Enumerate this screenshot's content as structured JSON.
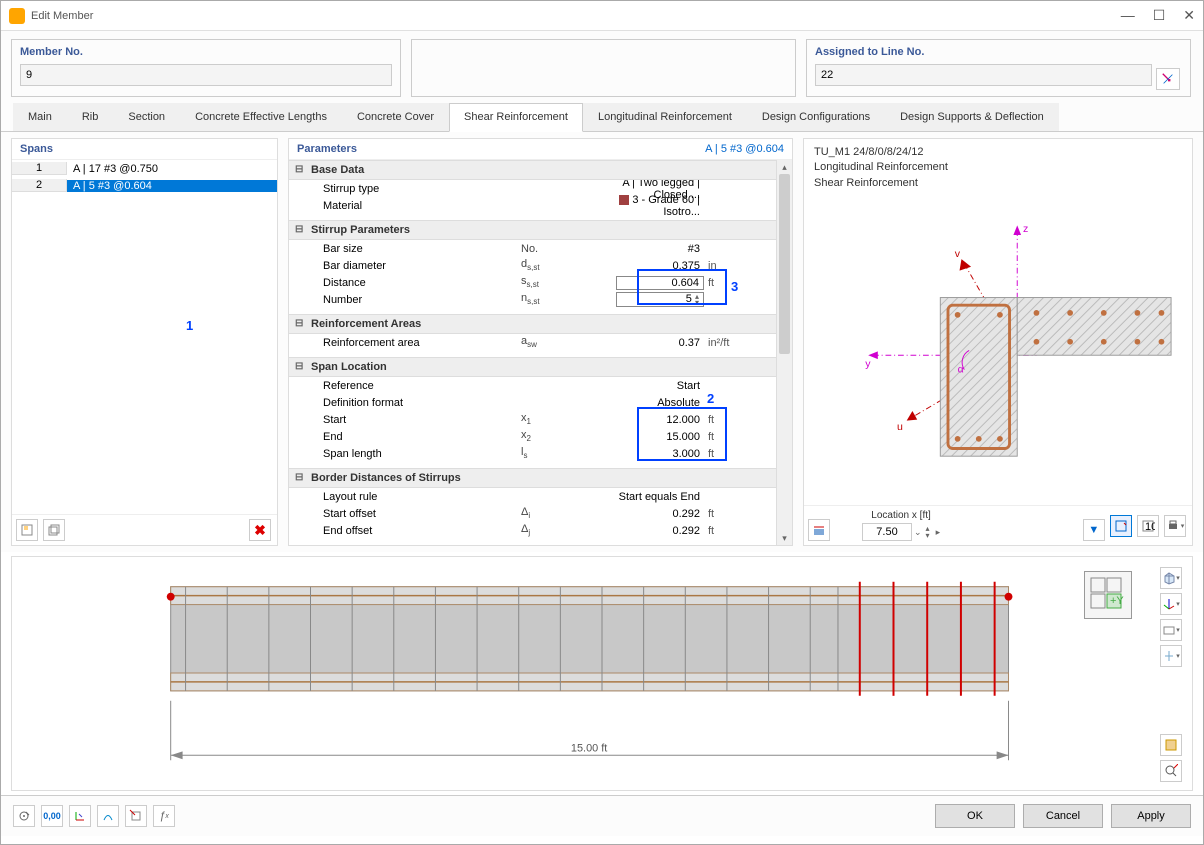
{
  "window": {
    "title": "Edit Member"
  },
  "header": {
    "member_label": "Member No.",
    "member_value": "9",
    "assigned_label": "Assigned to Line No.",
    "assigned_value": "22"
  },
  "tabs": [
    "Main",
    "Rib",
    "Section",
    "Concrete Effective Lengths",
    "Concrete Cover",
    "Shear Reinforcement",
    "Longitudinal Reinforcement",
    "Design Configurations",
    "Design Supports & Deflection"
  ],
  "active_tab": 5,
  "spans": {
    "title": "Spans",
    "rows": [
      {
        "n": "1",
        "label": "A | 17 #3 @0.750"
      },
      {
        "n": "2",
        "label": "A | 5 #3 @0.604"
      }
    ],
    "selected": 1
  },
  "parameters": {
    "title": "Parameters",
    "subtitle": "A | 5 #3 @0.604",
    "groups": [
      {
        "name": "Base Data",
        "rows": [
          {
            "label": "Stirrup type",
            "sym": "",
            "val": "A | Two legged | Closed ...",
            "unit": ""
          },
          {
            "label": "Material",
            "sym": "",
            "val": "3 - Grade 60 | Isotro...",
            "unit": "",
            "swatch": true
          }
        ]
      },
      {
        "name": "Stirrup Parameters",
        "rows": [
          {
            "label": "Bar size",
            "sym": "No.",
            "val": "#3",
            "unit": ""
          },
          {
            "label": "Bar diameter",
            "sym": "d",
            "sub": "s,st",
            "val": "0.375",
            "unit": "in"
          },
          {
            "label": "Distance",
            "sym": "s",
            "sub": "s,st",
            "val": "0.604",
            "unit": "ft",
            "hl": "blue",
            "editable": true
          },
          {
            "label": "Number",
            "sym": "n",
            "sub": "s,st",
            "val": "5",
            "unit": "",
            "hl": "blue",
            "editable": true,
            "spinner": true
          }
        ]
      },
      {
        "name": "Reinforcement Areas",
        "rows": [
          {
            "label": "Reinforcement area",
            "sym": "a",
            "sub": "sw",
            "val": "0.37",
            "unit": "in²/ft"
          }
        ]
      },
      {
        "name": "Span Location",
        "rows": [
          {
            "label": "Reference",
            "sym": "",
            "val": "Start",
            "unit": ""
          },
          {
            "label": "Definition format",
            "sym": "",
            "val": "Absolute",
            "unit": ""
          },
          {
            "label": "Start",
            "sym": "x",
            "sub": "1",
            "val": "12.000",
            "unit": "ft",
            "hl": "blue"
          },
          {
            "label": "End",
            "sym": "x",
            "sub": "2",
            "val": "15.000",
            "unit": "ft",
            "hl": "blue"
          },
          {
            "label": "Span length",
            "sym": "l",
            "sub": "s",
            "val": "3.000",
            "unit": "ft",
            "hl": "blue"
          }
        ]
      },
      {
        "name": "Border Distances of Stirrups",
        "rows": [
          {
            "label": "Layout rule",
            "sym": "",
            "val": "Start equals End",
            "unit": ""
          },
          {
            "label": "Start offset",
            "sym": "Δ",
            "sub": "i",
            "val": "0.292",
            "unit": "ft"
          },
          {
            "label": "End offset",
            "sym": "Δ",
            "sub": "j",
            "val": "0.292",
            "unit": "ft"
          }
        ]
      }
    ]
  },
  "preview": {
    "name": "TU_M1 24/8/0/8/24/12",
    "line1": "Longitudinal Reinforcement",
    "line2": "Shear Reinforcement",
    "loc_label": "Location x [ft]",
    "loc_value": "7.50"
  },
  "beam": {
    "length_label": "15.00 ft"
  },
  "callouts": {
    "c1": "1",
    "c2": "2",
    "c3": "3"
  },
  "footer": {
    "ok": "OK",
    "cancel": "Cancel",
    "apply": "Apply"
  }
}
